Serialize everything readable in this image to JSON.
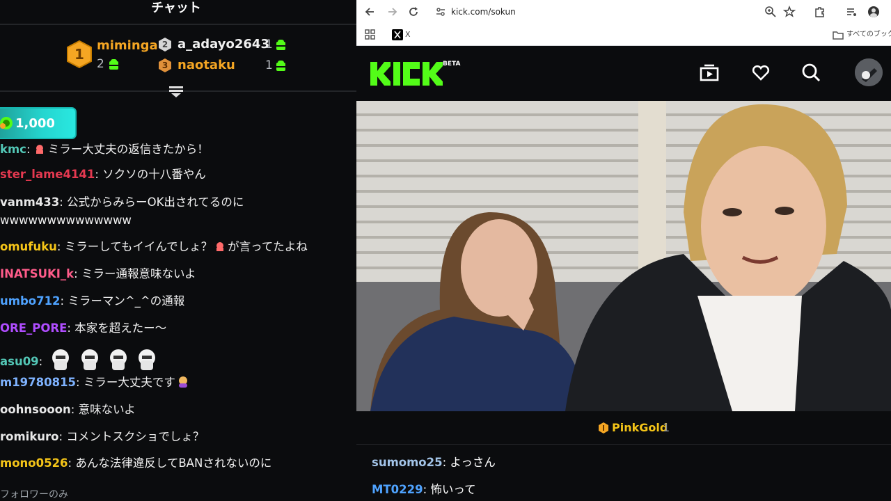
{
  "chat_panel": {
    "title": "チャット",
    "leaderboard": [
      {
        "rank": "1",
        "name": "miminga",
        "count": "2",
        "color": "#f5a623"
      },
      {
        "rank": "2",
        "name": "a_adayo2643",
        "count": "1",
        "color": "#e8e8e8"
      },
      {
        "rank": "3",
        "name": "naotaku",
        "count": "1",
        "color": "#f5a623"
      }
    ],
    "tip": {
      "amount": "1,000"
    },
    "messages": [
      {
        "user": "kmc",
        "text": "ミラー大丈夫の返信きたから！",
        "color": "#53c7b6"
      },
      {
        "user": "ster_lame4141",
        "text": "ソクソの十八番やん",
        "color": "#e53950"
      },
      {
        "user": "vanm433",
        "text": "公式からみらーOK出されてるのに",
        "continuation": "wwwwwwwwwwwwww",
        "color": "#e8e8e8"
      },
      {
        "user": "omufuku",
        "text": "ミラーしてもイイんでしょ？",
        "text_after_emoji": "が言ってたよね",
        "color": "#f5c518"
      },
      {
        "user": "INATSUKI_k",
        "text": "ミラー通報意味ないよ",
        "color": "#ff5c8a"
      },
      {
        "user": "umbo712",
        "text": "ミラーマン^_^の通報",
        "color": "#4fa3ff"
      },
      {
        "user": "ORE_PORE",
        "text": "本家を超えたー〜",
        "color": "#b04dff"
      },
      {
        "user": "asu09",
        "text": "",
        "color": "#53c7b6"
      },
      {
        "user": "m19780815",
        "text": "ミラー大丈夫です",
        "color": "#7fb3ff"
      },
      {
        "user": "oohnsooon",
        "text": "意味ないよ",
        "color": "#e8e8e8"
      },
      {
        "user": "romikuro",
        "text": "コメントスクショでしょ？",
        "color": "#e8e8e8"
      },
      {
        "user": "mono0526",
        "text": "あんな法律違反してBANされないのに",
        "color": "#f5c518"
      }
    ],
    "follower_note": "フォロワーのみ"
  },
  "browser": {
    "url": "kick.com/sokun",
    "bookmark_x": "X",
    "bookmark_folder": "すべてのブックマ"
  },
  "kick": {
    "logo_text": "KICK",
    "beta": "BETA",
    "accent": "#53fc18"
  },
  "gift_bar": {
    "name": "PinkGold",
    "count": "1"
  },
  "stream_chat": [
    {
      "user": "sumomo25",
      "text": "よっさん",
      "color": "#a3c4e8"
    },
    {
      "user": "MT0229",
      "text": "怖いって",
      "color": "#4fa3ff"
    }
  ]
}
